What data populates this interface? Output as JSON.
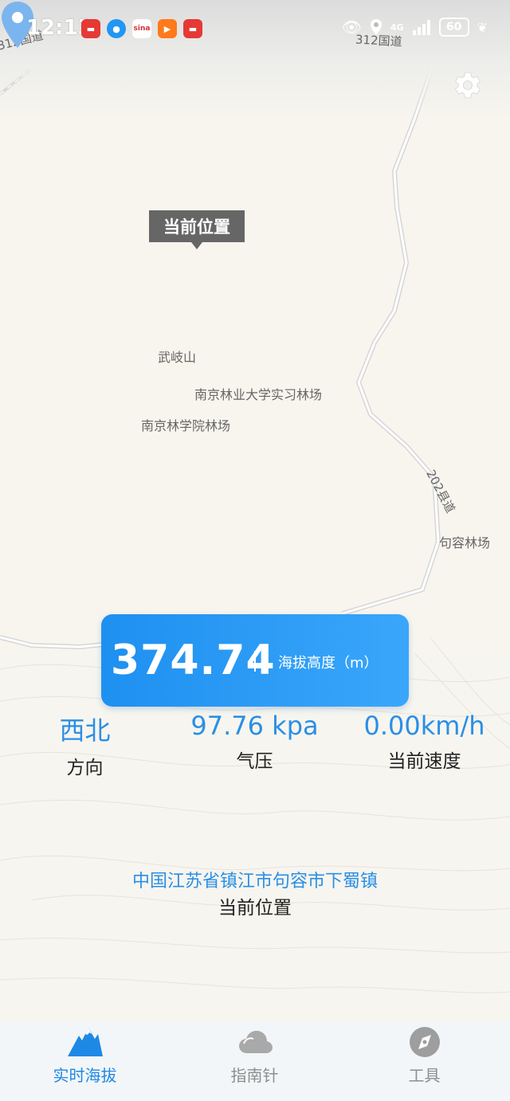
{
  "status_bar": {
    "time": "12:13",
    "app_icons": [
      "book-icon",
      "messenger-icon",
      "sina-icon",
      "video-icon",
      "book-icon"
    ],
    "network": "4G",
    "battery": "60"
  },
  "map": {
    "road_labels": [
      "312国道",
      "312国道",
      "202县道"
    ],
    "place_labels": [
      "武岐山",
      "南京林业大学实习林场",
      "南京林学院林场",
      "句容林场"
    ],
    "location_callout": "当前位置"
  },
  "altitude": {
    "value": "374.74",
    "label": "海拔高度（m）"
  },
  "stats": [
    {
      "value": "西北",
      "label": "方向"
    },
    {
      "value": "97.76 kpa",
      "label": "气压"
    },
    {
      "value": "0.00km/h",
      "label": "当前速度"
    }
  ],
  "location": {
    "address": "中国江苏省镇江市句容市下蜀镇",
    "label": "当前位置"
  },
  "tabs": [
    {
      "label": "实时海拔",
      "icon": "mountain-icon",
      "active": true
    },
    {
      "label": "指南针",
      "icon": "cloud-icon",
      "active": false
    },
    {
      "label": "工具",
      "icon": "compass-icon",
      "active": false
    }
  ],
  "colors": {
    "accent": "#1e88e5",
    "card": "#2196f3",
    "inactive": "#8d8d8d"
  }
}
